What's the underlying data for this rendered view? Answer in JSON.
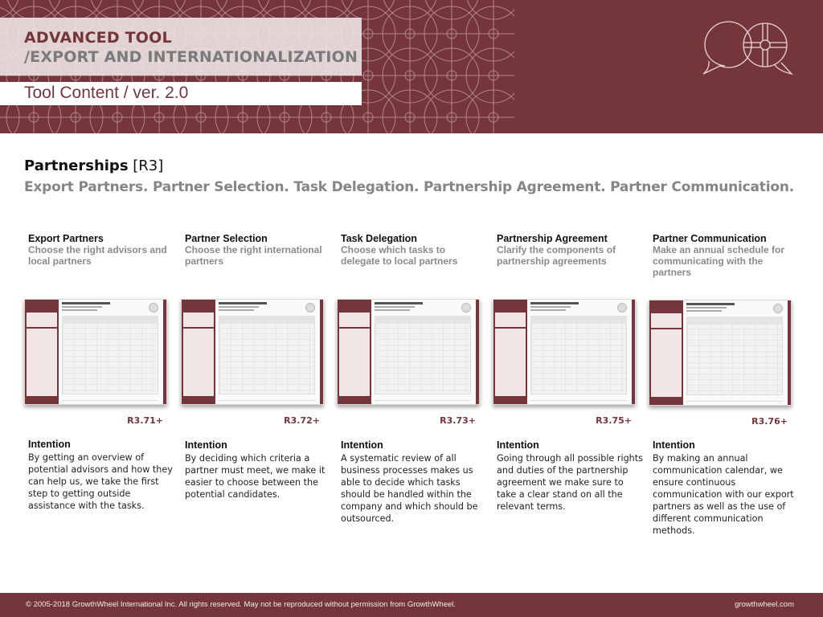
{
  "header": {
    "title_line1": "ADVANCED TOOL",
    "title_line2": "/EXPORT AND INTERNATIONALIZATION",
    "subtitle": "Tool Content / ver. 2.0",
    "logo_icon": "speech-bubbles-wheel-icon",
    "brand_color": "#74363a"
  },
  "section": {
    "title": "Partnerships",
    "code": "[R3]",
    "subtitle": "Export Partners. Partner Selection. Task Delegation. Partnership Agreement. Partner Communication."
  },
  "tools": [
    {
      "name": "Export Partners",
      "description": "Choose the right advisors and local partners",
      "code": "R3.71+",
      "thumbnail": "decision-sheet-thumbnail",
      "intention_label": "Intention",
      "intention": "By getting an overview of potential advisors and how they can help us, we take the first step to getting outside assistance with the tasks."
    },
    {
      "name": "Partner Selection",
      "description": "Choose the right international partners",
      "code": "R3.72+",
      "thumbnail": "decision-sheet-thumbnail",
      "intention_label": "Intention",
      "intention": "By deciding which criteria a partner must meet, we make it easier to choose between the potential candidates."
    },
    {
      "name": "Task Delegation",
      "description": "Choose which tasks to delegate to local partners",
      "code": "R3.73+",
      "thumbnail": "decision-sheet-thumbnail",
      "intention_label": "Intention",
      "intention": "A systematic review of all business processes makes us able to decide which tasks should be handled within the company and which should be outsourced."
    },
    {
      "name": "Partnership Agreement",
      "description": "Clarify the components of partnership agreements",
      "code": "R3.75+",
      "thumbnail": "decision-sheet-thumbnail",
      "intention_label": "Intention",
      "intention": "Going through all possible rights and duties of the partnership agreement we make sure to take a clear stand on all the relevant terms."
    },
    {
      "name": "Partner Communication",
      "description": "Make an annual schedule for communicating with the partners",
      "code": "R3.76+",
      "thumbnail": "decision-sheet-thumbnail",
      "intention_label": "Intention",
      "intention": "By making an annual communication calendar, we ensure continuous communication with our export partners as well as the use of different communication methods."
    }
  ],
  "footer": {
    "copyright": "© 2005-2018 GrowthWheel International Inc. All rights reserved. May not be reproduced without permission from GrowthWheel.",
    "website": "growthwheel.com"
  }
}
